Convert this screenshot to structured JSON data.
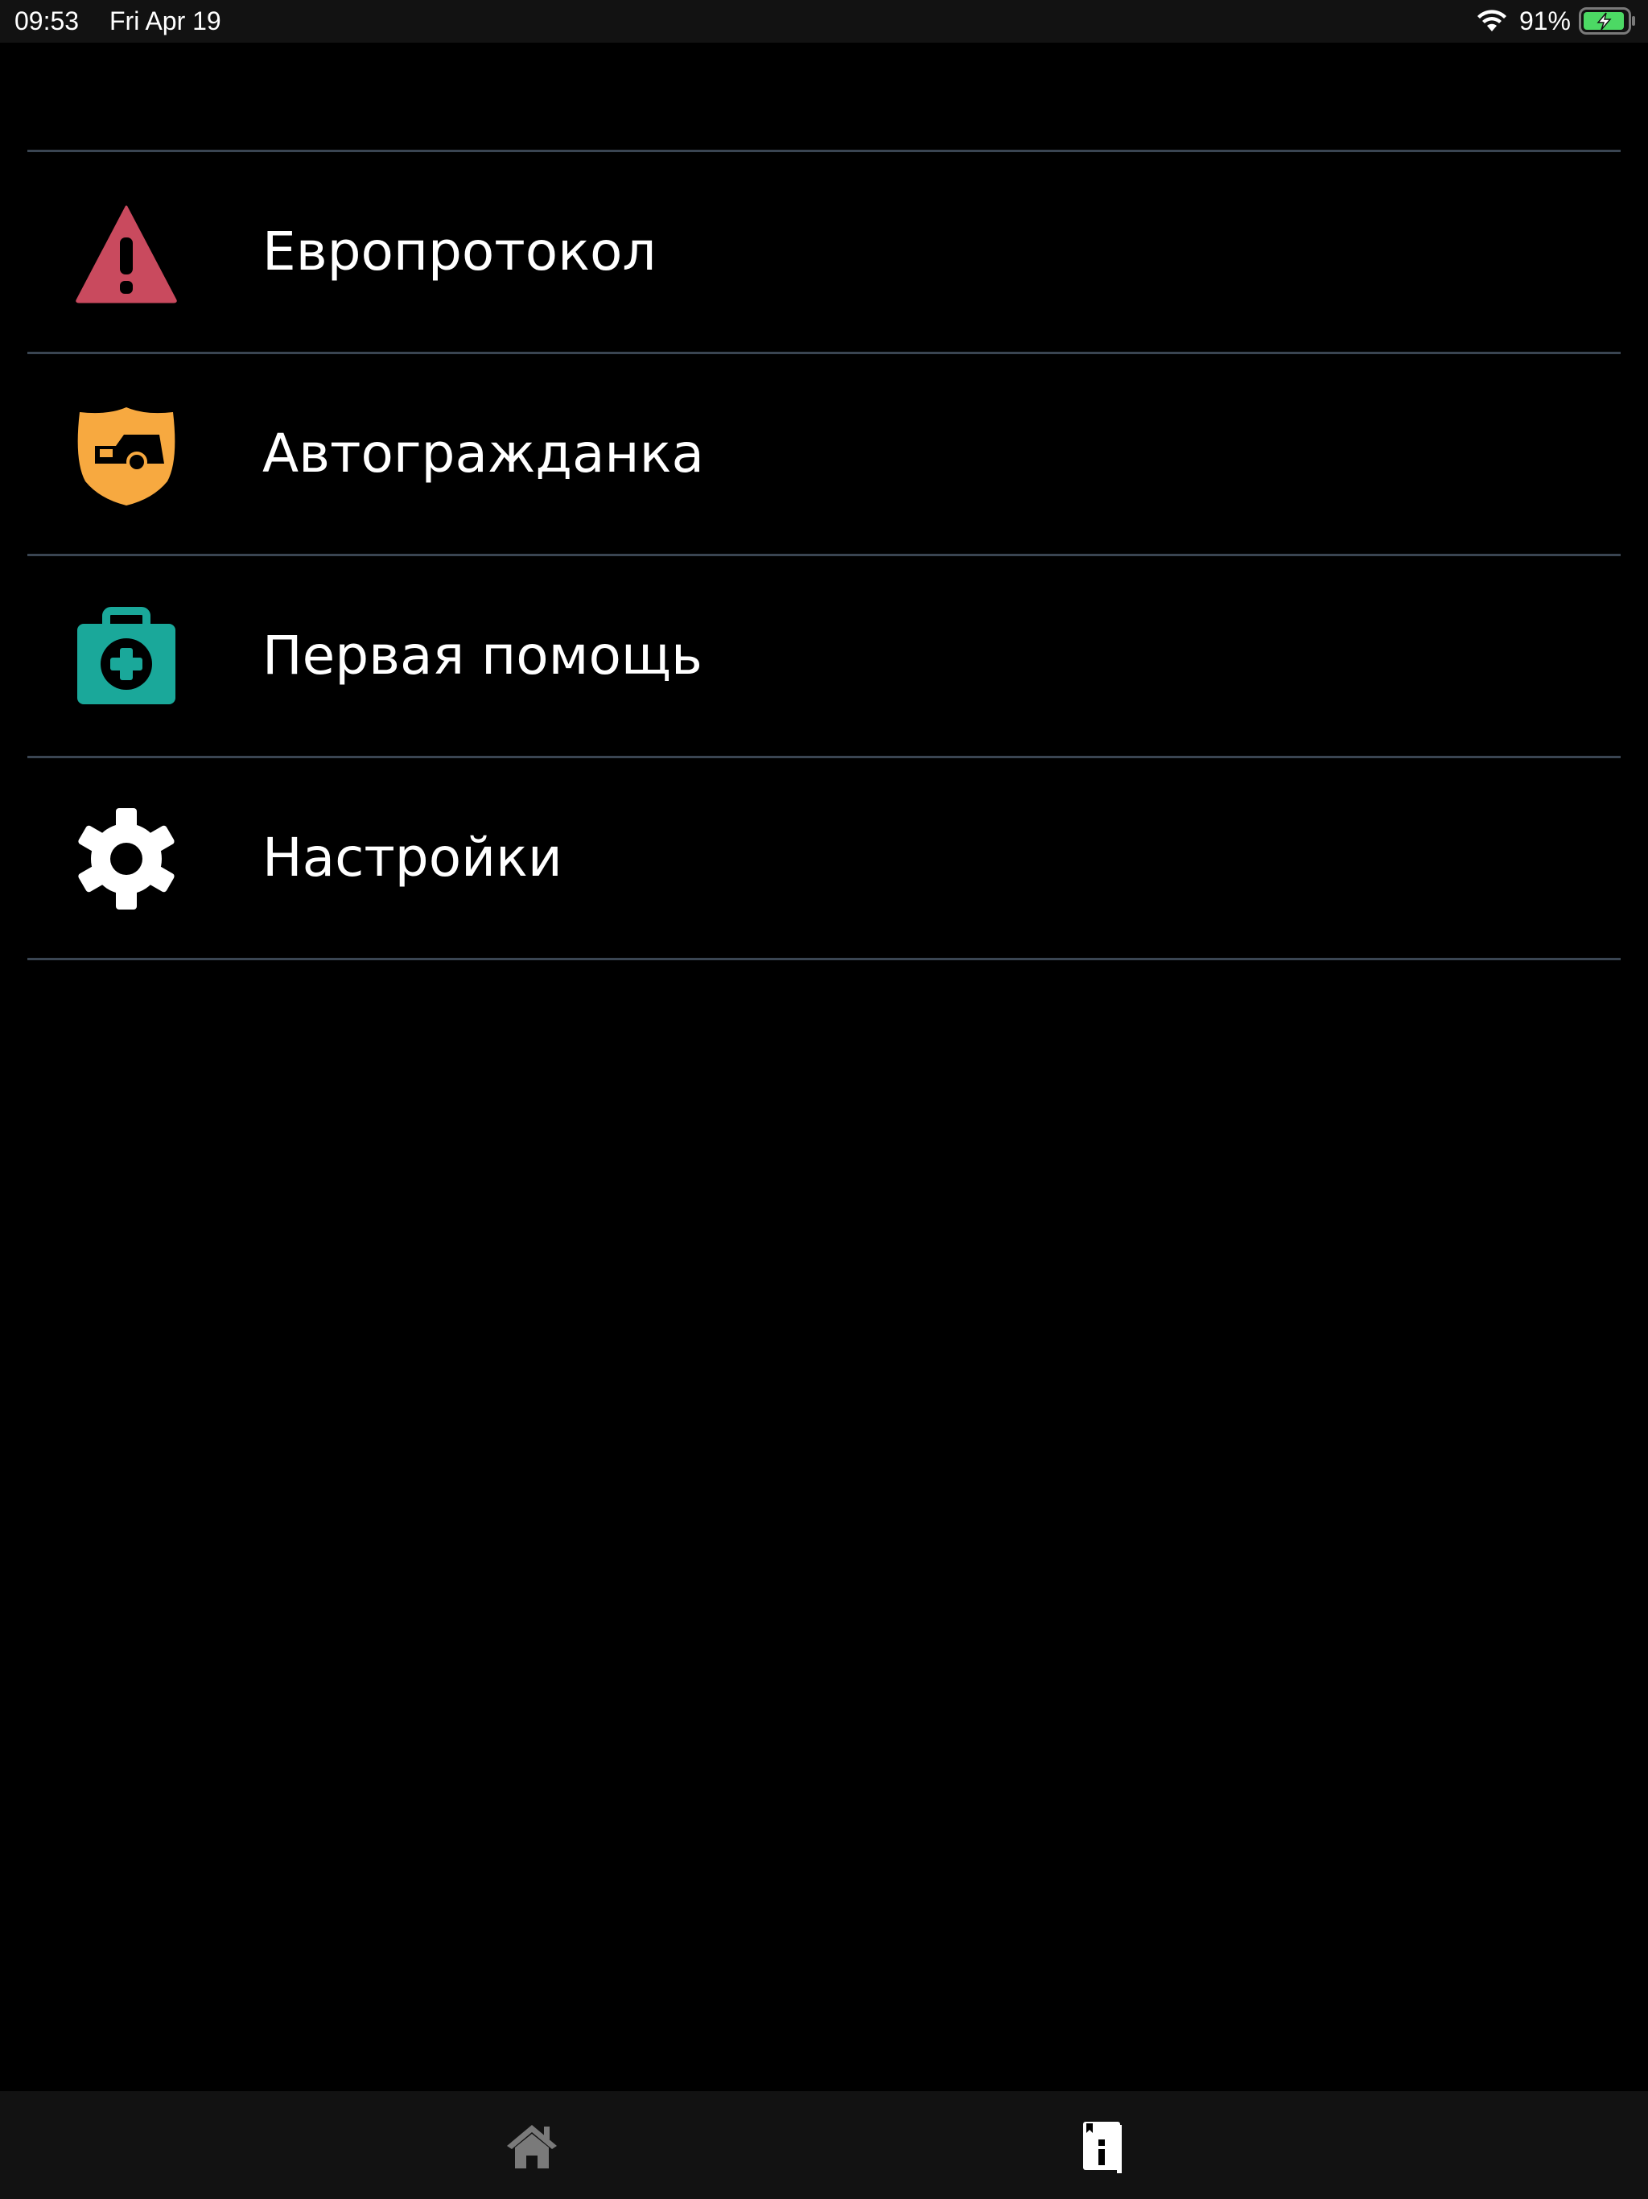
{
  "status_bar": {
    "time": "09:53",
    "date": "Fri Apr 19",
    "battery": "91%",
    "icons": [
      "wifi-icon",
      "battery-charging-icon"
    ]
  },
  "menu": {
    "items": [
      {
        "label": "Европротокол",
        "icon": "warning-triangle-icon",
        "icon_color": "#c94a5e"
      },
      {
        "label": "Автогражданка",
        "icon": "car-shield-icon",
        "icon_color": "#f7a940"
      },
      {
        "label": "Первая помощь",
        "icon": "first-aid-kit-icon",
        "icon_color": "#1aa89a"
      },
      {
        "label": "Настройки",
        "icon": "gear-icon",
        "icon_color": "#ffffff"
      }
    ]
  },
  "tab_bar": {
    "tabs": [
      {
        "icon": "home-icon",
        "selected": false
      },
      {
        "icon": "info-book-icon",
        "selected": true
      }
    ]
  },
  "colors": {
    "background": "#000000",
    "bars": "#121212",
    "divider": "#3a4552",
    "text": "#ffffff",
    "tab_inactive": "#7a7a7a",
    "battery": "#4cd964"
  }
}
